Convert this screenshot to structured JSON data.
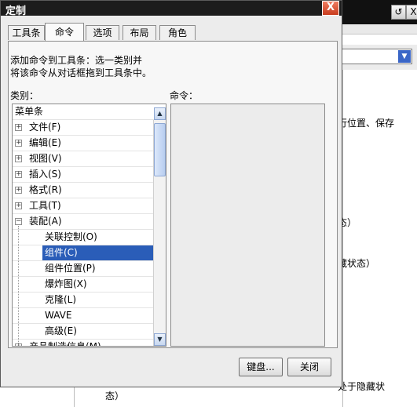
{
  "dialog": {
    "title": "定制",
    "close_glyph": "X",
    "tabs": [
      "工具条",
      "命令",
      "选项",
      "布局",
      "角色"
    ],
    "active_tab": "命令",
    "description_line1": "添加命令到工具条：选一类别并",
    "description_line2": "将该命令从对话框拖到工具条中。",
    "category_label": "类别：",
    "command_label": "命令：",
    "category_list": {
      "header": "菜单条",
      "items": [
        {
          "label": "文件(F)",
          "expander": "+"
        },
        {
          "label": "编辑(E)",
          "expander": "+"
        },
        {
          "label": "视图(V)",
          "expander": "+"
        },
        {
          "label": "插入(S)",
          "expander": "+"
        },
        {
          "label": "格式(R)",
          "expander": "+"
        },
        {
          "label": "工具(T)",
          "expander": "+"
        },
        {
          "label": "装配(A)",
          "expander": "−"
        }
      ],
      "sub_items": [
        "关联控制(O)",
        "组件(C)",
        "组件位置(P)",
        "爆炸图(X)",
        "克隆(L)",
        "WAVE",
        "高级(E)"
      ],
      "selected": "组件(C)",
      "clipped_item": "产品制造信息(M)"
    },
    "buttons": {
      "keyboard": "键盘...",
      "close": "关闭"
    }
  },
  "background": {
    "controls": [
      "↺",
      "X"
    ],
    "text_fragments": [
      "行位置、保存",
      "态）",
      "藏状态）",
      "处于隐藏状",
      "态）"
    ]
  },
  "colors": {
    "selection": "#2f5fbf",
    "titlebar": "#1c1c1c",
    "close_button": "#d9502f"
  }
}
